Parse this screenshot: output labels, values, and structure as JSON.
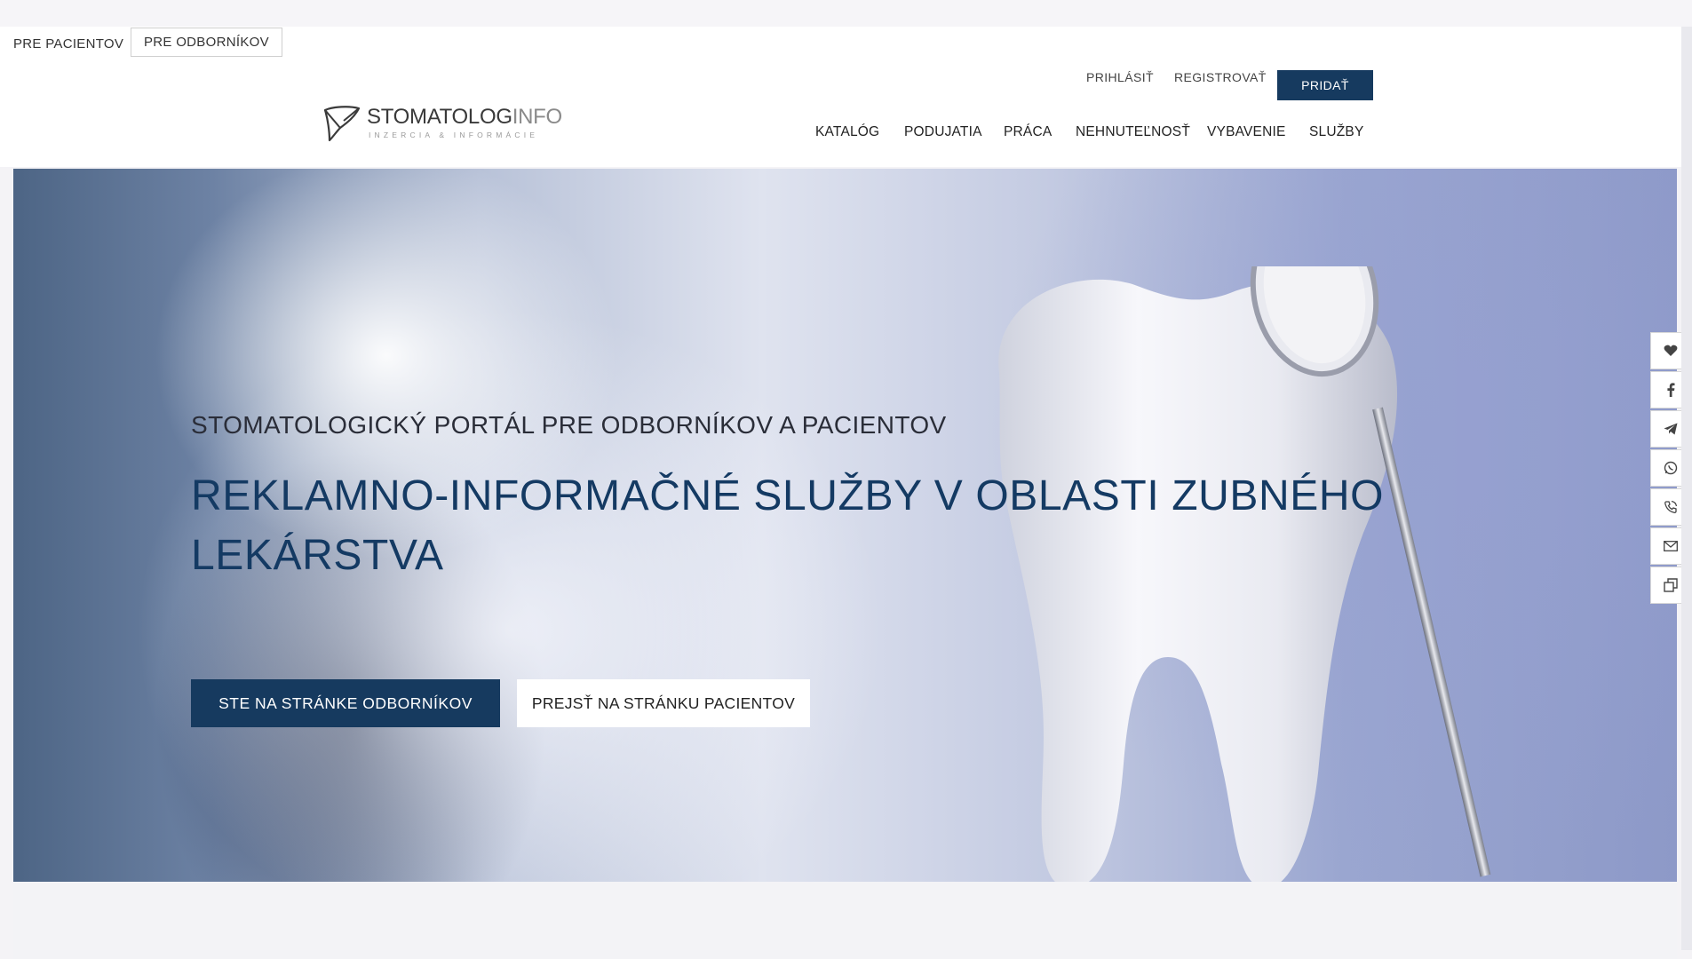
{
  "audience_tabs": {
    "patients": "PRE PACIENTOV",
    "professionals": "PRE ODBORNÍKOV"
  },
  "logo": {
    "name_main": "STOMATOLOG",
    "name_suffix": "INFO",
    "tagline": "INZERCIA & INFORMÁCIE"
  },
  "auth": {
    "login": "PRIHLÁSIŤ",
    "register": "REGISTROVAŤ",
    "add": "PRIDAŤ"
  },
  "nav": {
    "items": [
      "KATALÓG",
      "PODUJATIA",
      "PRÁCA",
      "NEHNUTEĽNOSŤ",
      "VYBAVENIE",
      "SLUŽBY"
    ]
  },
  "hero": {
    "subtitle": "STOMATOLOGICKÝ PORTÁL PRE ODBORNÍKOV A PACIENTOV",
    "title": "REKLAMNO-INFORMAČNÉ SLUŽBY V OBLASTI ZUBNÉHO LEKÁRSTVA",
    "btn_professionals": "STE NA STRÁNKE ODBORNÍKOV",
    "btn_patients": "PREJSŤ NA STRÁNKU PACIENTOV"
  },
  "social_icons": [
    "heart-icon",
    "facebook-icon",
    "telegram-icon",
    "whatsapp-icon",
    "viber-icon",
    "mail-icon",
    "copy-link-icon"
  ],
  "colors": {
    "primary": "#163a5f",
    "title": "#143a63"
  }
}
